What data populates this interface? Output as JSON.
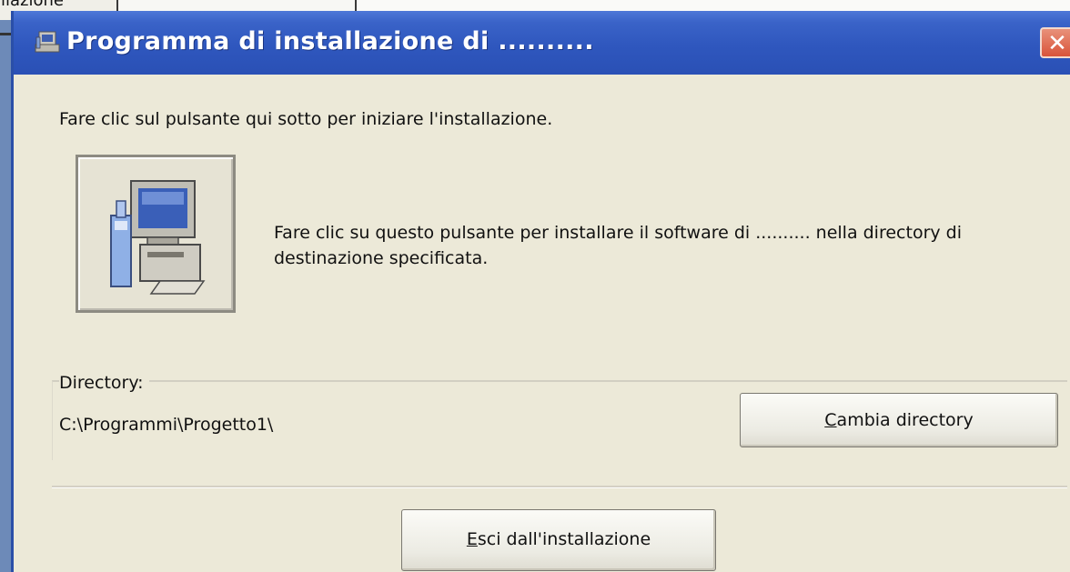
{
  "background": {
    "fragment_text": "allazione"
  },
  "dialog": {
    "title": "Programma di installazione di ..........",
    "close_glyph": "✕",
    "intro_text": "Fare clic sul pulsante qui sotto per iniziare l'installazione.",
    "install_button_icon": "computer-setup-icon",
    "install_description": "Fare clic su questo pulsante per installare il software di .......... nella directory di destinazione specificata.",
    "directory_group_label": "Directory:",
    "directory_value": "C:\\Programmi\\Progetto1\\",
    "change_directory": {
      "accesskey": "C",
      "rest": "ambia directory"
    },
    "exit_button": {
      "accesskey": "E",
      "rest": "sci dall'installazione"
    }
  },
  "colors": {
    "titlebar": "#2f57be",
    "dialog_bg": "#ece9d8",
    "close_button": "#d9543a"
  }
}
